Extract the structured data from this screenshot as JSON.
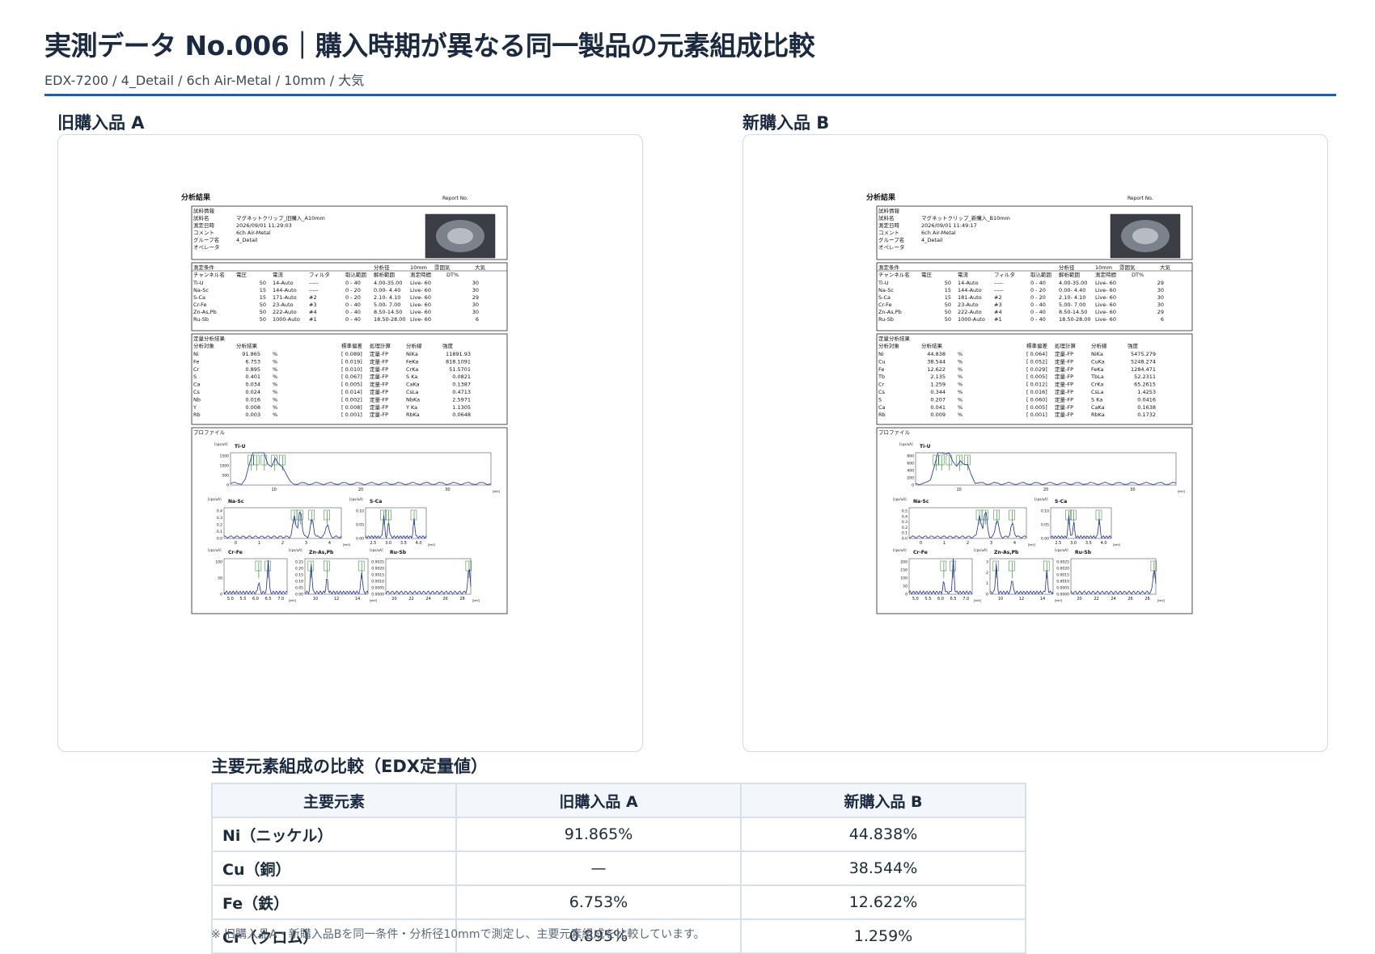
{
  "header": {
    "title": "実測データ No.006｜購入時期が異なる同一製品の元素組成比較",
    "subtitle": "EDX-7200 / 4_Detail / 6ch Air-Metal / 10mm / 大気"
  },
  "panels": [
    {
      "label": "旧購入品 A",
      "report": {
        "heading": "分析結果",
        "report_no": "Report No.",
        "info_title": "試料情報",
        "info": [
          [
            "試料名",
            "マグネットクリップ_旧購入_A10mm"
          ],
          [
            "測定日時",
            "2026/09/01 11:29:03"
          ],
          [
            "コメント",
            "6ch Air-Metal"
          ],
          [
            "グループ名",
            "4_Detail"
          ],
          [
            "オペレータ",
            ""
          ]
        ],
        "cond_title": "測定条件",
        "cond_extra": [
          "分析径",
          "10mm",
          "雰囲気",
          "大気"
        ],
        "cond_header": [
          "チャンネル名",
          "電圧",
          "電流",
          "フィルタ",
          "取込範囲",
          "解析範囲",
          "測定時間",
          "DT%"
        ],
        "cond_rows": [
          [
            "Ti-U",
            "50",
            "14-Auto",
            "-----",
            "0 - 40",
            "4.00-35.00",
            "Live- 60",
            "30"
          ],
          [
            "Na-Sc",
            "15",
            "144-Auto",
            "-----",
            "0 - 20",
            "0.00- 4.40",
            "Live- 60",
            "30"
          ],
          [
            "S-Ca",
            "15",
            "171-Auto",
            "#2",
            "0 - 20",
            "2.10- 4.10",
            "Live- 60",
            "29"
          ],
          [
            "Cr-Fe",
            "50",
            "23-Auto",
            "#3",
            "0 - 40",
            "5.00- 7.00",
            "Live- 60",
            "30"
          ],
          [
            "Zn-As,Pb",
            "50",
            "222-Auto",
            "#4",
            "0 - 40",
            "8.50-14.50",
            "Live- 60",
            "30"
          ],
          [
            "Ru-Sb",
            "50",
            "1000-Auto",
            "#1",
            "0 - 40",
            "18.50-28.00",
            "Live- 60",
            "6"
          ]
        ],
        "quant_title": "定量分析結果",
        "quant_header": [
          "分析対象",
          "分析結果",
          "標準偏差",
          "処理計算",
          "分析線",
          "強度"
        ],
        "quant_rows": [
          [
            "Ni",
            "91.865",
            "%",
            "[ 0.089]",
            "定量-FP",
            "NiKa",
            "11891.93"
          ],
          [
            "Fe",
            "6.753",
            "%",
            "[ 0.019]",
            "定量-FP",
            "FeKa",
            "818.1091"
          ],
          [
            "Cr",
            "0.895",
            "%",
            "[ 0.010]",
            "定量-FP",
            "CrKa",
            "51.5701"
          ],
          [
            "S",
            "0.401",
            "%",
            "[ 0.067]",
            "定量-FP",
            "S Ka",
            "0.0821"
          ],
          [
            "Ca",
            "0.034",
            "%",
            "[ 0.005]",
            "定量-FP",
            "CaKa",
            "0.1387"
          ],
          [
            "Cs",
            "0.024",
            "%",
            "[ 0.014]",
            "定量-FP",
            "CsLa",
            "0.4713"
          ],
          [
            "Nb",
            "0.016",
            "%",
            "[ 0.002]",
            "定量-FP",
            "NbKa",
            "2.5971"
          ],
          [
            "Y",
            "0.008",
            "%",
            "[ 0.008]",
            "定量-FP",
            "Y Ka",
            "1.1305"
          ],
          [
            "Rb",
            "0.003",
            "%",
            "[ 0.001]",
            "定量-FP",
            "RbKa",
            "0.0648"
          ]
        ],
        "profile_title": "プロファイル",
        "plots": [
          {
            "name": "Ti-U",
            "unit": "[cps/uA]",
            "yticks": [
              "1500",
              "1000",
              "500",
              "0"
            ],
            "xticks": [
              "10",
              "20",
              "30"
            ],
            "xunit": "[keV]"
          },
          {
            "name": "Na-Sc",
            "unit": "[cps/uA]",
            "yticks": [
              "0.4",
              "0.3",
              "0.2",
              "0.1",
              "0.0"
            ],
            "xticks": [
              "0",
              "1",
              "2",
              "3",
              "4"
            ],
            "xunit": "[keV]"
          },
          {
            "name": "S-Ca",
            "unit": "[cps/uA]",
            "yticks": [
              "0.10",
              "0.05",
              "0.00"
            ],
            "xticks": [
              "2.5",
              "3.0",
              "3.5",
              "4.0"
            ],
            "xunit": "[keV]"
          },
          {
            "name": "Cr-Fe",
            "unit": "[cps/uA]",
            "yticks": [
              "100",
              "50",
              "0"
            ],
            "xticks": [
              "5.0",
              "5.5",
              "6.0",
              "6.5",
              "7.0"
            ],
            "xunit": "[keV]"
          },
          {
            "name": "Zn-As,Pb",
            "unit": "[cps/uA]",
            "yticks": [
              "0.25",
              "0.20",
              "0.15",
              "0.10",
              "0.05",
              "0.00"
            ],
            "xticks": [
              "10",
              "12",
              "14"
            ],
            "xunit": "[keV]"
          },
          {
            "name": "Ru-Sb",
            "unit": "[cps/uA]",
            "yticks": [
              "0.0025",
              "0.0020",
              "0.0015",
              "0.0010",
              "0.0005",
              "0.0000"
            ],
            "xticks": [
              "20",
              "22",
              "24",
              "26",
              "28"
            ],
            "xunit": "[keV]"
          }
        ]
      }
    },
    {
      "label": "新購入品 B",
      "report": {
        "heading": "分析結果",
        "report_no": "Report No.",
        "info_title": "試料情報",
        "info": [
          [
            "試料名",
            "マグネットクリップ_新購入_B10mm"
          ],
          [
            "測定日時",
            "2026/09/01 11:49:17"
          ],
          [
            "コメント",
            "6ch Air-Metal"
          ],
          [
            "グループ名",
            "4_Detail"
          ],
          [
            "オペレータ",
            ""
          ]
        ],
        "cond_title": "測定条件",
        "cond_extra": [
          "分析径",
          "10mm",
          "雰囲気",
          "大気"
        ],
        "cond_header": [
          "チャンネル名",
          "電圧",
          "電流",
          "フィルタ",
          "取込範囲",
          "解析範囲",
          "測定時間",
          "DT%"
        ],
        "cond_rows": [
          [
            "Ti-U",
            "50",
            "14-Auto",
            "-----",
            "0 - 40",
            "4.00-35.00",
            "Live- 60",
            "29"
          ],
          [
            "Na-Sc",
            "15",
            "144-Auto",
            "-----",
            "0 - 20",
            "0.00- 4.40",
            "Live- 60",
            "30"
          ],
          [
            "S-Ca",
            "15",
            "181-Auto",
            "#2",
            "0 - 20",
            "2.10- 4.10",
            "Live- 60",
            "30"
          ],
          [
            "Cr-Fe",
            "50",
            "23-Auto",
            "#3",
            "0 - 40",
            "5.00- 7.00",
            "Live- 60",
            "30"
          ],
          [
            "Zn-As,Pb",
            "50",
            "222-Auto",
            "#4",
            "0 - 40",
            "8.50-14.50",
            "Live- 60",
            "29"
          ],
          [
            "Ru-Sb",
            "50",
            "1000-Auto",
            "#1",
            "0 - 40",
            "18.50-28.00",
            "Live- 60",
            "6"
          ]
        ],
        "quant_title": "定量分析結果",
        "quant_header": [
          "分析対象",
          "分析結果",
          "標準偏差",
          "処理計算",
          "分析線",
          "強度"
        ],
        "quant_rows": [
          [
            "Ni",
            "44.838",
            "%",
            "[ 0.064]",
            "定量-FP",
            "NiKa",
            "5475.279"
          ],
          [
            "Cu",
            "38.544",
            "%",
            "[ 0.052]",
            "定量-FP",
            "CuKa",
            "5248.274"
          ],
          [
            "Fe",
            "12.622",
            "%",
            "[ 0.029]",
            "定量-FP",
            "FeKa",
            "1284.471"
          ],
          [
            "Tb",
            "2.135",
            "%",
            "[ 0.005]",
            "定量-FP",
            "TbLa",
            "52.2311"
          ],
          [
            "Cr",
            "1.259",
            "%",
            "[ 0.012]",
            "定量-FP",
            "CrKa",
            "65.2615"
          ],
          [
            "Cs",
            "0.344",
            "%",
            "[ 0.016]",
            "定量-FP",
            "CsLa",
            "1.4253"
          ],
          [
            "S",
            "0.207",
            "%",
            "[ 0.060]",
            "定量-FP",
            "S Ka",
            "0.0416"
          ],
          [
            "Ca",
            "0.041",
            "%",
            "[ 0.005]",
            "定量-FP",
            "CaKa",
            "0.1638"
          ],
          [
            "Rb",
            "0.009",
            "%",
            "[ 0.001]",
            "定量-FP",
            "RbKa",
            "0.1732"
          ]
        ],
        "profile_title": "プロファイル",
        "plots": [
          {
            "name": "Ti-U",
            "unit": "[cps/uA]",
            "yticks": [
              "800",
              "600",
              "400",
              "200",
              "0"
            ],
            "xticks": [
              "10",
              "20",
              "30"
            ],
            "xunit": "[keV]"
          },
          {
            "name": "Na-Sc",
            "unit": "[cps/uA]",
            "yticks": [
              "0.5",
              "0.4",
              "0.3",
              "0.2",
              "0.1",
              "0.0"
            ],
            "xticks": [
              "0",
              "1",
              "2",
              "3",
              "4"
            ],
            "xunit": "[keV]"
          },
          {
            "name": "S-Ca",
            "unit": "[cps/uA]",
            "yticks": [
              "0.10",
              "0.05",
              "0.00"
            ],
            "xticks": [
              "2.5",
              "3.0",
              "3.5",
              "4.0"
            ],
            "xunit": "[keV]"
          },
          {
            "name": "Cr-Fe",
            "unit": "[cps/uA]",
            "yticks": [
              "200",
              "150",
              "100",
              "50",
              "0"
            ],
            "xticks": [
              "5.0",
              "5.5",
              "6.0",
              "6.5",
              "7.0"
            ],
            "xunit": "[keV]"
          },
          {
            "name": "Zn-As,Pb",
            "unit": "[cps/uA]",
            "yticks": [
              "3",
              "2",
              "1",
              "0"
            ],
            "xticks": [
              "10",
              "12",
              "14"
            ],
            "xunit": "[keV]"
          },
          {
            "name": "Ru-Sb",
            "unit": "[cps/uA]",
            "yticks": [
              "0.0025",
              "0.0020",
              "0.0015",
              "0.0010",
              "0.0005",
              "0.0000"
            ],
            "xticks": [
              "20",
              "22",
              "24",
              "26",
              "28"
            ],
            "xunit": "[keV]"
          }
        ]
      }
    }
  ],
  "comparison": {
    "title": "主要元素組成の比較（EDX定量値）",
    "headers": [
      "主要元素",
      "旧購入品 A",
      "新購入品 B"
    ],
    "rows": [
      [
        "Ni（ニッケル）",
        "91.865%",
        "44.838%"
      ],
      [
        "Cu（銅）",
        "—",
        "38.544%"
      ],
      [
        "Fe（鉄）",
        "6.753%",
        "12.622%"
      ],
      [
        "Cr（クロム）",
        "0.895%",
        "1.259%"
      ]
    ]
  },
  "note": "※ 旧購入品A・新購入品Bを同一条件・分析径10mmで測定し、主要元素組成を比較しています。",
  "colors": {
    "accent": "#1e5fa8",
    "spectrum": "#1a2ea0",
    "peak_label": "#1f7a1f"
  }
}
